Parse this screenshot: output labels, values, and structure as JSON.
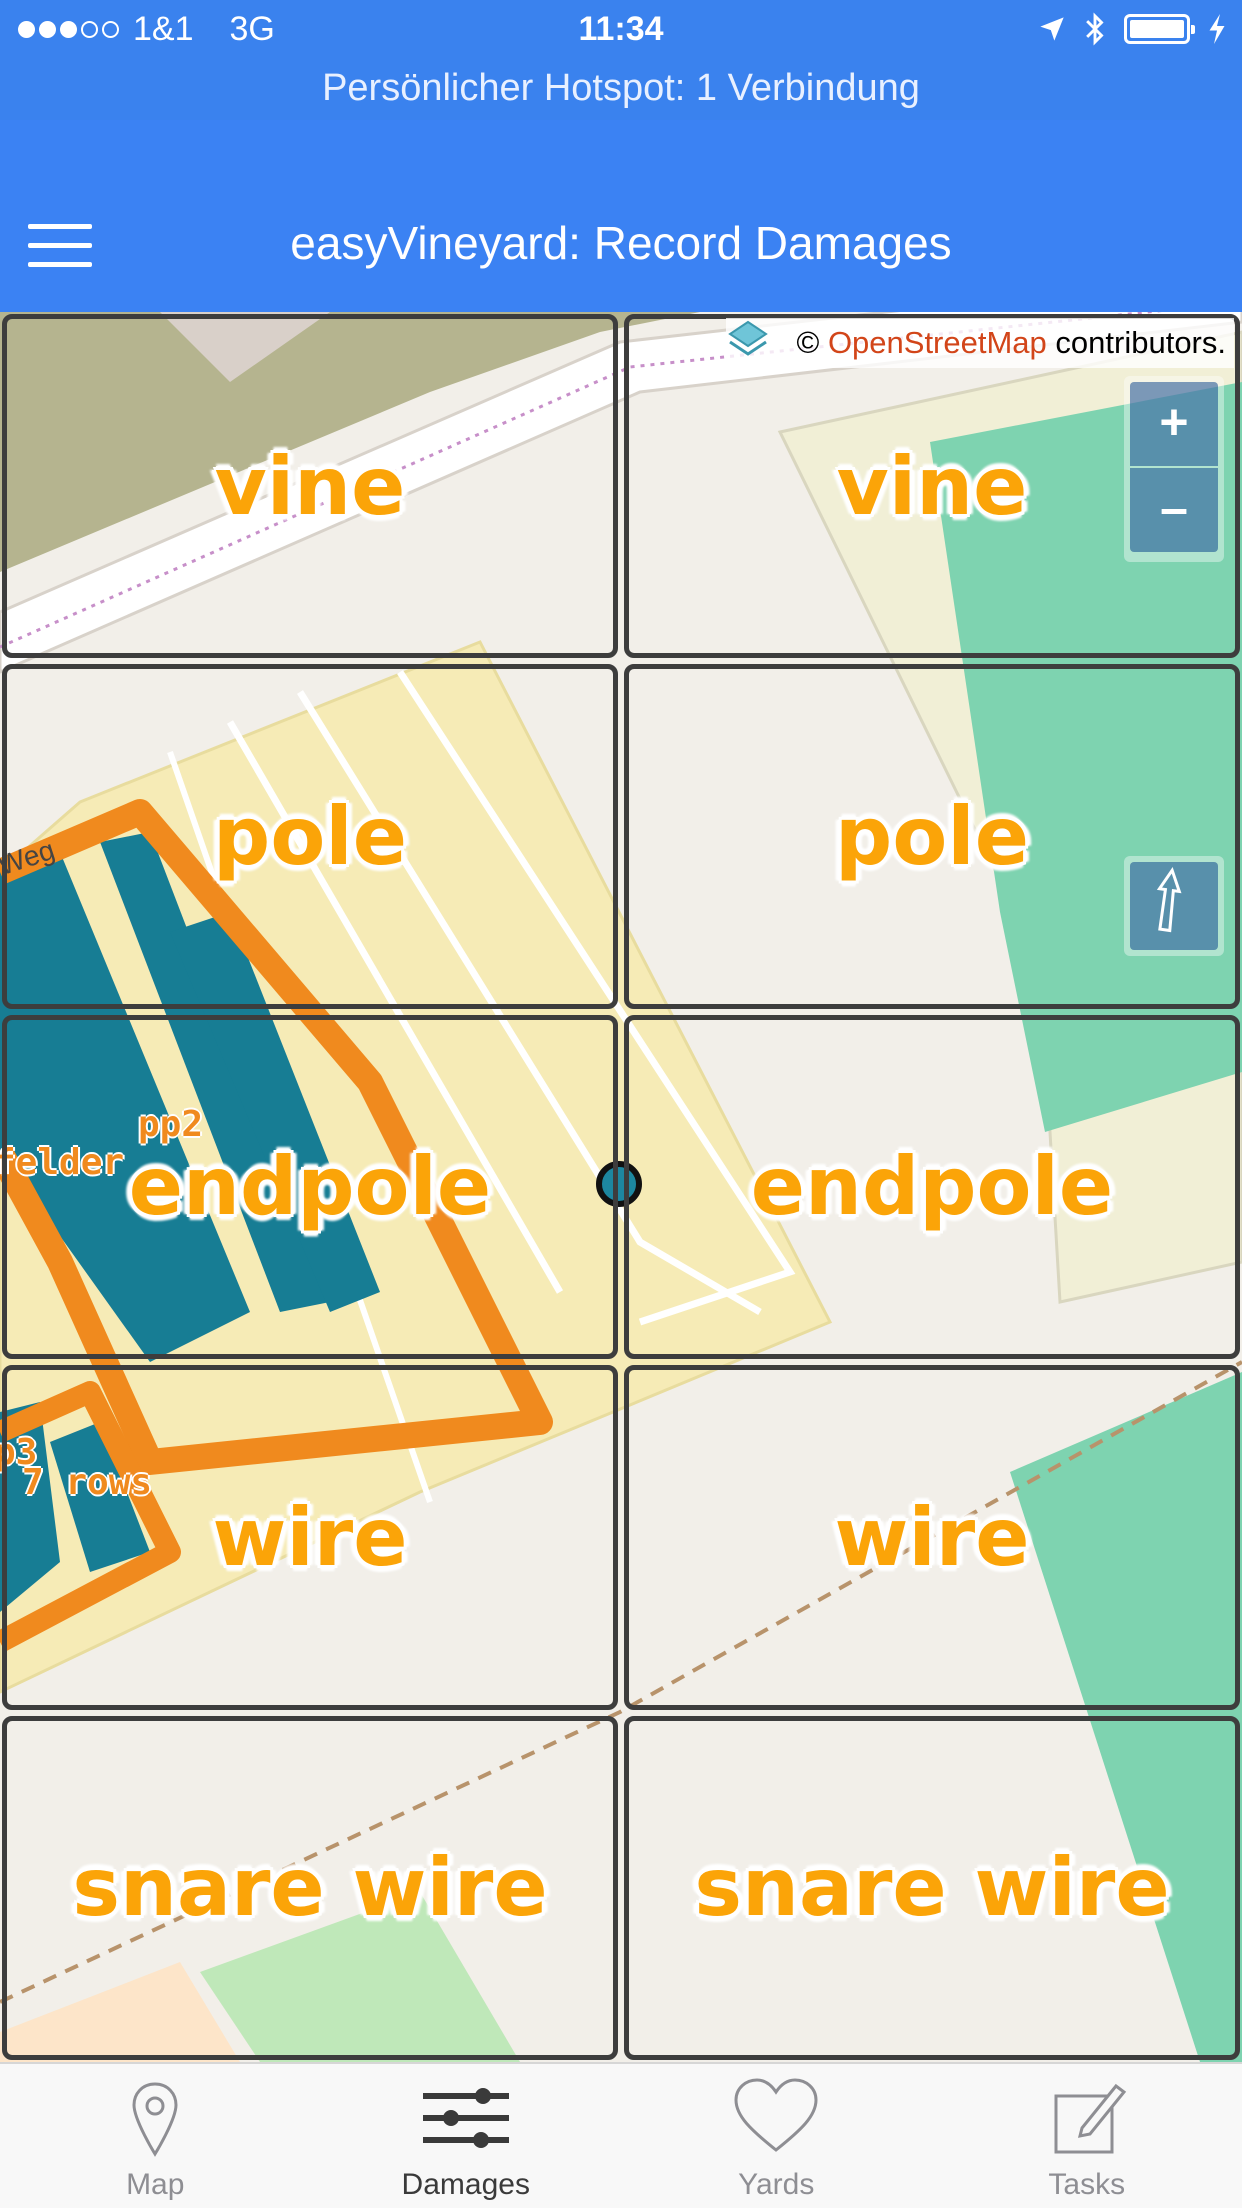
{
  "status_bar": {
    "carrier": "1&1",
    "network": "3G",
    "time": "11:34",
    "signal_dots_filled": 3,
    "signal_dots_total": 5
  },
  "hotspot_banner": "Persönlicher Hotspot: 1 Verbindung",
  "nav": {
    "title": "easyVineyard: Record Damages",
    "menu_icon": "hamburger-menu-icon"
  },
  "map": {
    "attribution_prefix": "©",
    "attribution_link": "OpenStreetMap",
    "attribution_suffix": "contributors.",
    "zoom_in": "+",
    "zoom_out": "–",
    "labels": {
      "pp2": "pp2",
      "felder": "felder",
      "p3": "p3",
      "rows": "7 rows",
      "street": "Weg"
    }
  },
  "damage_grid": [
    [
      "vine",
      "vine"
    ],
    [
      "pole",
      "pole"
    ],
    [
      "endpole",
      "endpole"
    ],
    [
      "wire",
      "wire"
    ],
    [
      "snare wire",
      "snare wire"
    ]
  ],
  "colors": {
    "accent": "#3b82f3",
    "label_orange": "#fba408",
    "vineyard_outline": "#f08a1e",
    "rows_blue": "#177d94",
    "forest_green": "#7ed3b0"
  },
  "tabs": [
    {
      "label": "Map",
      "icon": "map-pin-icon",
      "active": false
    },
    {
      "label": "Damages",
      "icon": "sliders-icon",
      "active": true
    },
    {
      "label": "Yards",
      "icon": "heart-icon",
      "active": false
    },
    {
      "label": "Tasks",
      "icon": "edit-icon",
      "active": false
    }
  ]
}
